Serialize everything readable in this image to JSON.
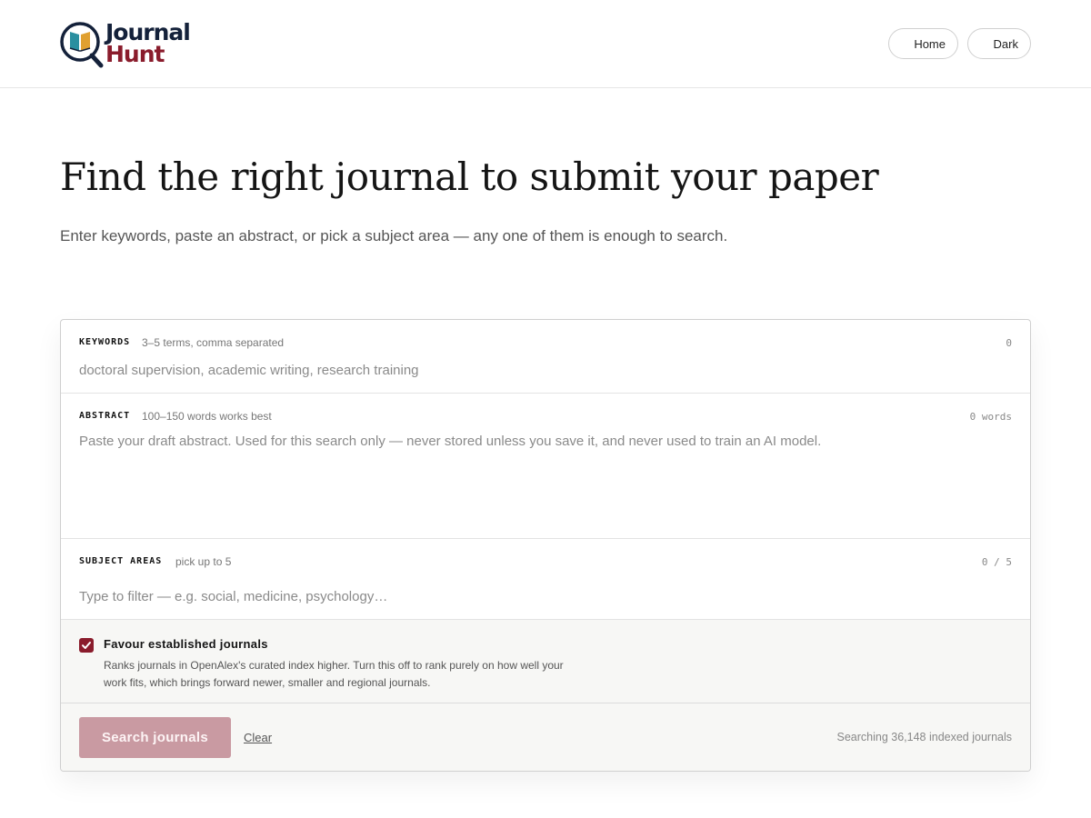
{
  "brand": {
    "name_line1": "Journal",
    "name_line2": "Hunt",
    "colors": {
      "navy": "#14213a",
      "maroon": "#8a1c2c",
      "teal": "#2a8fa0",
      "gold": "#e0a030"
    }
  },
  "nav": {
    "home_label": "Home",
    "dark_label": "Dark"
  },
  "hero": {
    "title": "Find the right journal to submit your paper",
    "subtitle": "Enter keywords, paste an abstract, or pick a subject area — any one of them is enough to search."
  },
  "form": {
    "keywords": {
      "label": "KEYWORDS",
      "hint": "3–5 terms, comma separated",
      "count": "0",
      "value": "",
      "placeholder": "doctoral supervision, academic writing, research training"
    },
    "abstract": {
      "label": "ABSTRACT",
      "hint": "100–150 words works best",
      "count": "0 words",
      "value": "",
      "placeholder": "Paste your draft abstract. Used for this search only — never stored unless you save it, and never used to train an AI model."
    },
    "subjects": {
      "label": "SUBJECT AREAS",
      "hint": "pick up to 5",
      "count": "0 / 5",
      "value": "",
      "placeholder": "Type to filter — e.g. social, medicine, psychology…"
    },
    "favour_established": {
      "checked": true,
      "title": "Favour established journals",
      "description": "Ranks journals in OpenAlex's curated index higher. Turn this off to rank purely on how well your work fits, which brings forward newer, smaller and regional journals."
    },
    "actions": {
      "search_label": "Search journals",
      "clear_label": "Clear",
      "status": "Searching 36,148 indexed journals"
    }
  }
}
